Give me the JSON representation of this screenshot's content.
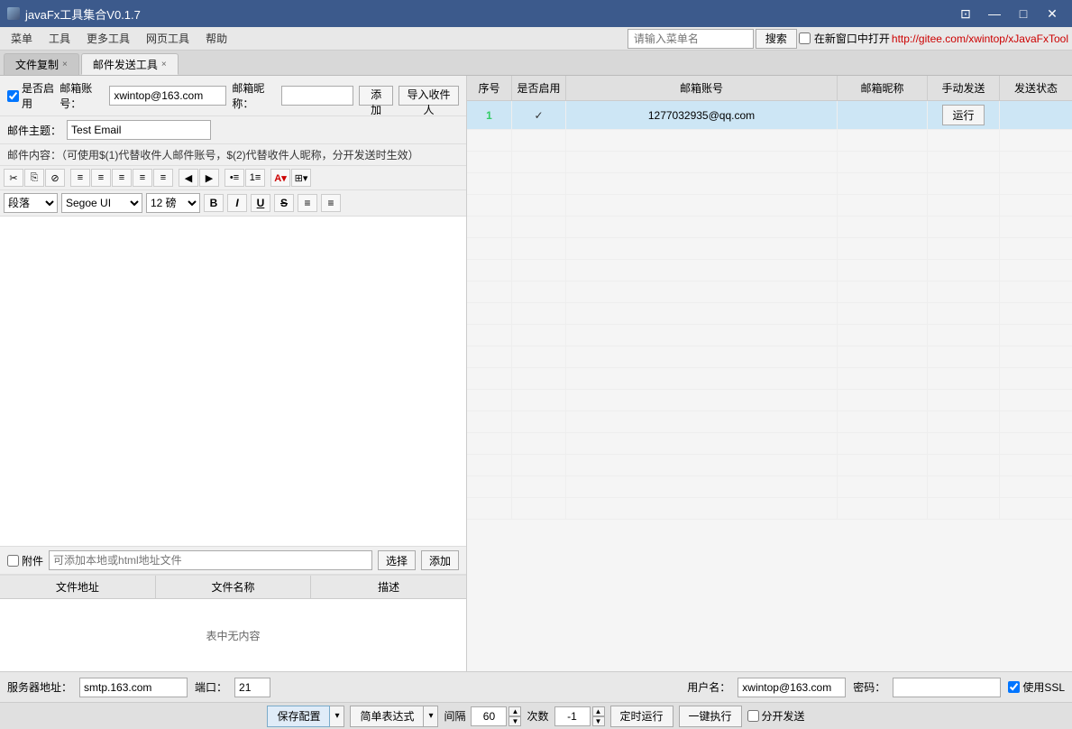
{
  "window": {
    "title": "javaFx工具集合V0.1.7",
    "controls": {
      "minimize": "—",
      "maximize": "□",
      "close": "✕",
      "restore": "⊡"
    }
  },
  "menubar": {
    "items": [
      "菜单",
      "工具",
      "更多工具",
      "网页工具",
      "帮助"
    ],
    "search_placeholder": "请输入菜单名",
    "search_btn": "搜索",
    "new_window_label": "在新窗口中打开",
    "link": "http://gitee.com/xwintop/xJavaFxTool"
  },
  "tabs": [
    {
      "label": "文件复制",
      "closable": true
    },
    {
      "label": "邮件发送工具",
      "closable": true,
      "active": true
    }
  ],
  "left": {
    "email_enabled_label": "是否启用",
    "email_account_label": "邮箱账号：",
    "email_account_value": "xwintop@163.com",
    "email_nickname_label": "邮箱昵称：",
    "email_nickname_value": "",
    "add_btn": "添加",
    "import_btn": "导入收件人",
    "subject_label": "邮件主题：",
    "subject_value": "Test Email",
    "content_label": "邮件内容：（可使用$(1)代替收件人邮件账号，$(2)代替收件人昵称，分开发送时生效）",
    "toolbar_btns": [
      "✂",
      "⎘",
      "⊘",
      "≡",
      "≡",
      "≡",
      "≡",
      "≡",
      "←",
      "→",
      "•≡",
      "1≡",
      "A▾",
      "⊞▾"
    ],
    "para_label": "段落",
    "font_label": "Segoe UI",
    "size_label": "12 磅",
    "bold": "B",
    "italic": "I",
    "underline": "U",
    "strikethrough": "S",
    "align": "≡",
    "attachment_label": "附件",
    "attachment_path_placeholder": "可添加本地或html地址文件",
    "choose_btn": "选择",
    "attach_add_btn": "添加",
    "table_headers": [
      "文件地址",
      "文件名称",
      "描述"
    ],
    "table_empty": "表中无内容"
  },
  "right": {
    "headers": [
      "序号",
      "是否启用",
      "邮箱账号",
      "邮箱昵称",
      "手动发送",
      "发送状态"
    ],
    "rows": [
      {
        "seq": "1",
        "enabled": true,
        "account": "1277032935@qq.com",
        "nickname": "",
        "run_btn": "运行",
        "status": ""
      }
    ],
    "empty_rows": 18
  },
  "bottom": {
    "server_label": "服务器地址：",
    "server_value": "smtp.163.com",
    "port_label": "端口：",
    "port_value": "21",
    "user_label": "用户名：",
    "user_value": "xwintop@163.com",
    "pass_label": "密码：",
    "pass_value": "",
    "ssl_label": "使用SSL"
  },
  "action": {
    "save_btn": "保存配置",
    "mode_btn": "简单表达式",
    "interval_label": "间隔",
    "interval_value": "60",
    "count_label": "次数",
    "count_value": "-1",
    "timer_btn": "定时运行",
    "onekey_btn": "一键执行",
    "split_label": "分开发送"
  }
}
